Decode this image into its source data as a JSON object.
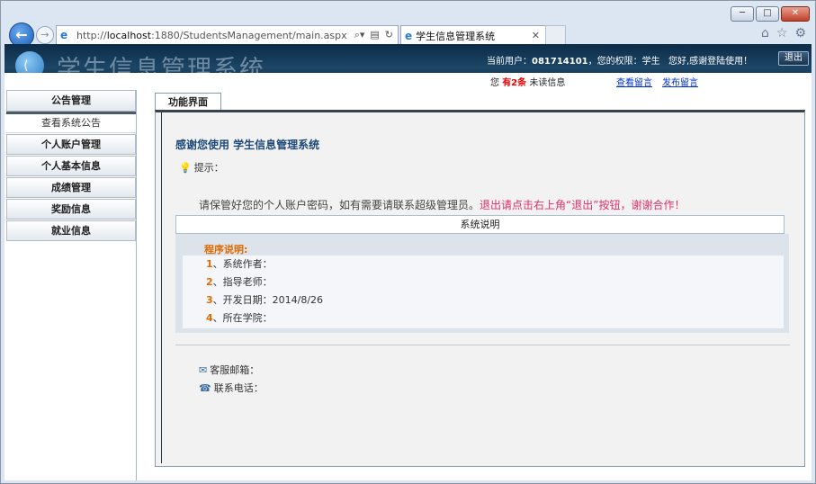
{
  "browser": {
    "url_prefix": "http://",
    "url_host": "localhost",
    "url_rest": ":1880/StudentsManagement/main.aspx",
    "tab_title": "学生信息管理系统",
    "window_controls": [
      "─",
      "□",
      "✕"
    ]
  },
  "header": {
    "app_title": "学生信息管理系统",
    "current_user_label": "当前用户：",
    "current_user_id": "081714101",
    "permission_text": "，您的权限：学生",
    "welcome": "您好,感谢登陆使用！",
    "logout_label": "退出",
    "unread_prefix": "您",
    "unread_count": "有2条",
    "unread_suffix": "未读信息",
    "view_messages": "查看留言",
    "post_message": "发布留言"
  },
  "sidebar": {
    "head": "公告管理",
    "sub": "查看系统公告",
    "items": [
      "个人账户管理",
      "个人基本信息",
      "成绩管理",
      "奖励信息",
      "就业信息"
    ]
  },
  "main": {
    "tab_label": "功能界面",
    "heading": "感谢您使用 学生信息管理系统",
    "tip_label": "提示：",
    "notice_plain": "请保管好您的个人账户密码，如有需要请联系超级管理员。",
    "notice_highlight": "退出请点击右上角“退出”按钮，谢谢合作！",
    "system_desc": "系统说明",
    "program_title": "程序说明:",
    "program_items": [
      {
        "num": "1",
        "text": "、系统作者："
      },
      {
        "num": "2",
        "text": "、指导老师："
      },
      {
        "num": "3",
        "text": "、开发日期：2014/8/26"
      },
      {
        "num": "4",
        "text": "、所在学院："
      }
    ],
    "email_label": "客服邮箱：",
    "phone_label": "联系电话："
  },
  "colors": {
    "banner": "#1c4666",
    "accent_orange": "#e26a00",
    "highlight_pink": "#e0306a",
    "link_blue": "#0033cc"
  }
}
